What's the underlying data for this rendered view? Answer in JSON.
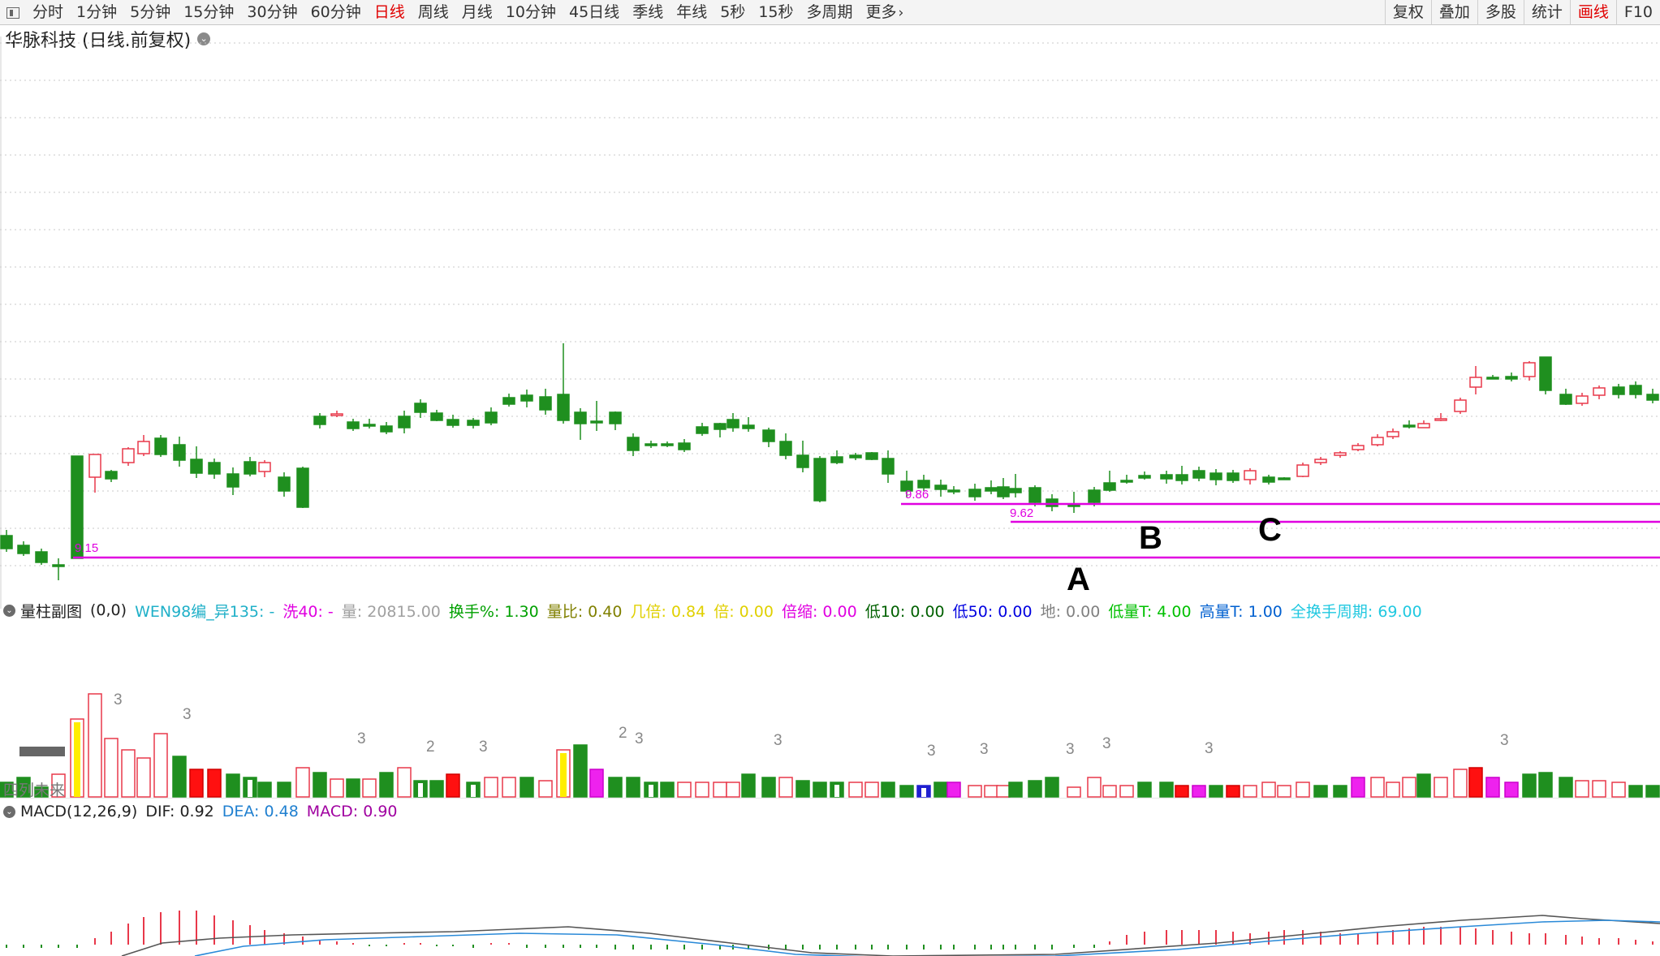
{
  "toolbar": {
    "left_items": [
      "分时",
      "1分钟",
      "5分钟",
      "15分钟",
      "30分钟",
      "60分钟",
      "日线",
      "周线",
      "月线",
      "10分钟",
      "45日线",
      "季线",
      "年线",
      "5秒",
      "15秒",
      "多周期",
      "更多"
    ],
    "active_left": "日线",
    "more_chevron": "›",
    "right_items": [
      "复权",
      "叠加",
      "多股",
      "统计",
      "画线",
      "F10"
    ],
    "active_right": "画线"
  },
  "stock_title": "华脉科技 (日线.前复权)",
  "main_chart": {
    "price_labels": [
      {
        "text": "9.15",
        "color": "#e000e0"
      },
      {
        "text": "9.86",
        "color": "#e000e0"
      },
      {
        "text": "9.62",
        "color": "#e000e0"
      }
    ],
    "point_labels": [
      "A",
      "B",
      "C"
    ],
    "line_color": "#e000e0"
  },
  "volume_header": [
    {
      "text": "量柱副图",
      "color": "#222222"
    },
    {
      "text": "(0,0)",
      "color": "#222222"
    },
    {
      "text": "WEN98编_异135: -",
      "color": "#20b0c8"
    },
    {
      "text": "洗40: -",
      "color": "#e000e0"
    },
    {
      "text": "量: 20815.00",
      "color": "#a0a0a0"
    },
    {
      "text": "换手%: 1.30",
      "color": "#00a000"
    },
    {
      "text": "量比: 0.40",
      "color": "#808000"
    },
    {
      "text": "几倍: 0.84",
      "color": "#e0d000"
    },
    {
      "text": "倍: 0.00",
      "color": "#e0d000"
    },
    {
      "text": "倍缩: 0.00",
      "color": "#e000e0"
    },
    {
      "text": "低10: 0.00",
      "color": "#006000"
    },
    {
      "text": "低50: 0.00",
      "color": "#0000e0"
    },
    {
      "text": "地: 0.00",
      "color": "#808080"
    },
    {
      "text": "低量T: 4.00",
      "color": "#00c000"
    },
    {
      "text": "高量T: 1.00",
      "color": "#0060d0"
    },
    {
      "text": "全换手周期: 69.00",
      "color": "#20c8e0"
    }
  ],
  "volume_marks": [
    "3",
    "3",
    "3",
    "2",
    "3",
    "2",
    "3",
    "3",
    "3",
    "3",
    "3",
    "3",
    "3",
    "3"
  ],
  "volume_side_label": "四列未来",
  "macd_header": [
    {
      "text": "MACD(12,26,9)",
      "color": "#222222"
    },
    {
      "text": "DIF: 0.92",
      "color": "#222222"
    },
    {
      "text": "DEA: 0.48",
      "color": "#2080d0"
    },
    {
      "text": "MACD: 0.90",
      "color": "#a000a0"
    }
  ],
  "colors": {
    "up": "#e8384a",
    "down": "#1f8f1f",
    "magenta": "#e000e0",
    "yellow": "#ffee00",
    "grid": "#c8c8c8"
  },
  "icons": {
    "panel": "panel-toggle-icon",
    "collapse": "collapse-circle-icon"
  }
}
